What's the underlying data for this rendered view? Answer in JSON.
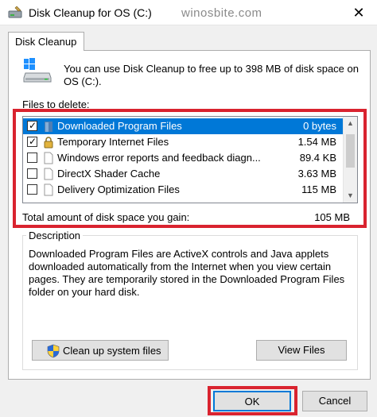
{
  "window": {
    "title": "Disk Cleanup for OS (C:)",
    "watermark": "winosbite.com",
    "close_glyph": "✕"
  },
  "tab": {
    "label": "Disk Cleanup"
  },
  "intro_text": "You can use Disk Cleanup to free up to 398 MB of disk space on OS (C:).",
  "files_label": "Files to delete:",
  "files": [
    {
      "name": "Downloaded Program Files",
      "size": "0 bytes",
      "checked": true,
      "selected": true,
      "icon": "folder-icon"
    },
    {
      "name": "Temporary Internet Files",
      "size": "1.54 MB",
      "checked": true,
      "selected": false,
      "icon": "lock-icon"
    },
    {
      "name": "Windows error reports and feedback diagn...",
      "size": "89.4 KB",
      "checked": false,
      "selected": false,
      "icon": "file-icon"
    },
    {
      "name": "DirectX Shader Cache",
      "size": "3.63 MB",
      "checked": false,
      "selected": false,
      "icon": "file-icon"
    },
    {
      "name": "Delivery Optimization Files",
      "size": "115 MB",
      "checked": false,
      "selected": false,
      "icon": "file-icon"
    }
  ],
  "total": {
    "label": "Total amount of disk space you gain:",
    "value": "105 MB"
  },
  "description": {
    "title": "Description",
    "text": "Downloaded Program Files are ActiveX controls and Java applets downloaded automatically from the Internet when you view certain pages. They are temporarily stored in the Downloaded Program Files folder on your hard disk."
  },
  "buttons": {
    "cleanup": "Clean up system files",
    "view": "View Files",
    "ok": "OK",
    "cancel": "Cancel"
  },
  "colors": {
    "accent": "#0078d7",
    "highlight_box": "#d9232f"
  }
}
